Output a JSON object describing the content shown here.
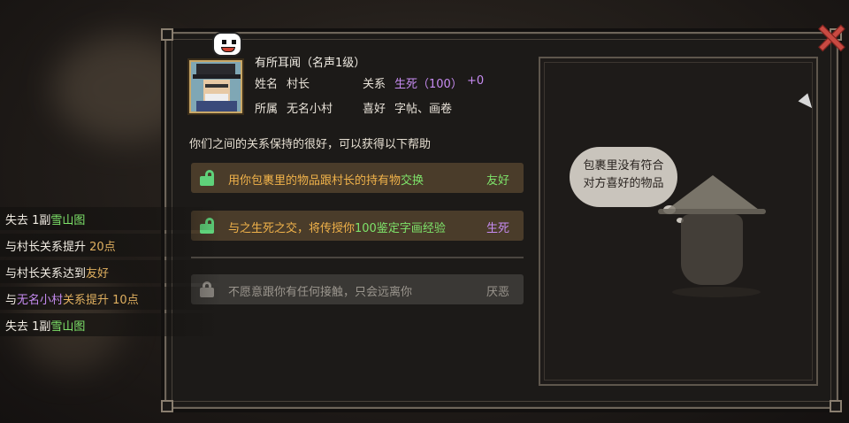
{
  "dialog": {
    "title": "有所耳闻（名声1级）",
    "name_label": "姓名",
    "name_value": "村长",
    "relation_label": "关系",
    "relation_value": "生死（100）",
    "relation_delta": "+0",
    "affiliation_label": "所属",
    "affiliation_value": "无名小村",
    "hobby_label": "喜好",
    "hobby_value": "字帖、画卷",
    "description": "你们之间的关系保持的很好，可以获得以下帮助"
  },
  "benefits": [
    {
      "text_a": "用你包裹里的物品跟村长的持有物",
      "text_b": "交换",
      "tag": "友好",
      "unlocked": true
    },
    {
      "text_a": "与之生死之交，将传授你",
      "text_b": "100鉴定字画经验",
      "tag": "生死",
      "unlocked": true
    },
    {
      "text_a": "不愿意跟你有任何接触，只会远离你",
      "text_b": "",
      "tag": "厌恶",
      "unlocked": false
    }
  ],
  "bubble": {
    "line1": "包裹里没有符合",
    "line2": "对方喜好的物品"
  },
  "log": [
    {
      "a": "失去 1副",
      "b": "雪山图",
      "c": ""
    },
    {
      "a": "与村长关系提升 ",
      "b": "20点",
      "c": ""
    },
    {
      "a": "与村长关系达到",
      "b": "友好",
      "c": ""
    },
    {
      "a": "与",
      "b": "无名小村",
      "c": "关系提升 10点"
    },
    {
      "a": "失去 1副",
      "b": "雪山图",
      "c": ""
    }
  ],
  "colors": {
    "purple": "#c78cf2",
    "green": "#7ee36a",
    "orange": "#f0b24a",
    "close": "#c84a42"
  },
  "icons": {
    "close": "close-x-icon",
    "emote": "grin-emote-icon",
    "lock_open": "unlocked-icon",
    "lock_closed": "locked-icon"
  }
}
